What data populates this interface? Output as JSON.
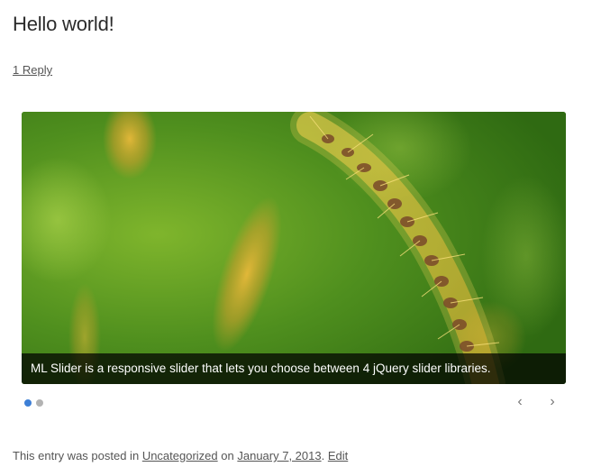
{
  "post": {
    "title": "Hello world!",
    "reply_link": "1 Reply"
  },
  "slider": {
    "image": "grass-seed-head-photo",
    "caption": "ML Slider is a responsive slider that lets you choose between 4 jQuery slider libraries.",
    "active_slide": 1,
    "slide_count": 2,
    "prev_icon": "chevron-left-icon",
    "next_icon": "chevron-right-icon",
    "prev_glyph": "‹",
    "next_glyph": "›",
    "colors": {
      "active_dot": "#3d7fd6",
      "inactive_dot": "#b3b3b3"
    }
  },
  "meta": {
    "prefix": "This entry was posted in",
    "category": "Uncategorized",
    "on_text": "on",
    "date": "January 7, 2013",
    "separator": ".",
    "edit": "Edit"
  }
}
